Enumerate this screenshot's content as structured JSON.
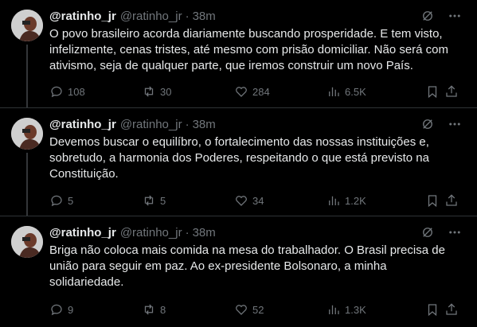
{
  "tweets": [
    {
      "name": "@ratinho_jr",
      "handle": "@ratinho_jr",
      "time": "38m",
      "text": "O povo brasileiro acorda diariamente buscando prosperidade. E tem visto,\ninfelizmente, cenas tristes, até mesmo com prisão domiciliar. Não será com\nativismo, seja de qualquer parte, que iremos construir um novo País.",
      "replies": "108",
      "retweets": "30",
      "likes": "284",
      "views": "6.5K"
    },
    {
      "name": "@ratinho_jr",
      "handle": "@ratinho_jr",
      "time": "38m",
      "text": "Devemos buscar o equilíbro, o fortalecimento das nossas instituições e,\nsobretudo, a harmonia dos Poderes,  respeitando o que está previsto na\nConstituição.",
      "replies": "5",
      "retweets": "5",
      "likes": "34",
      "views": "1.2K"
    },
    {
      "name": "@ratinho_jr",
      "handle": "@ratinho_jr",
      "time": "38m",
      "text": "Briga não coloca mais comida na mesa do trabalhador. O Brasil precisa de\nunião para seguir em paz. Ao ex-presidente Bolsonaro, a minha\nsolidariedade.",
      "replies": "9",
      "retweets": "8",
      "likes": "52",
      "views": "1.3K"
    }
  ],
  "separator": "·",
  "icons": [
    "grok-icon",
    "more-icon",
    "reply-icon",
    "retweet-icon",
    "like-icon",
    "views-icon",
    "bookmark-icon",
    "share-icon"
  ],
  "colors": {
    "background": "#000000",
    "text": "#e7e9ea",
    "muted": "#71767b",
    "divider": "#2f3336"
  }
}
